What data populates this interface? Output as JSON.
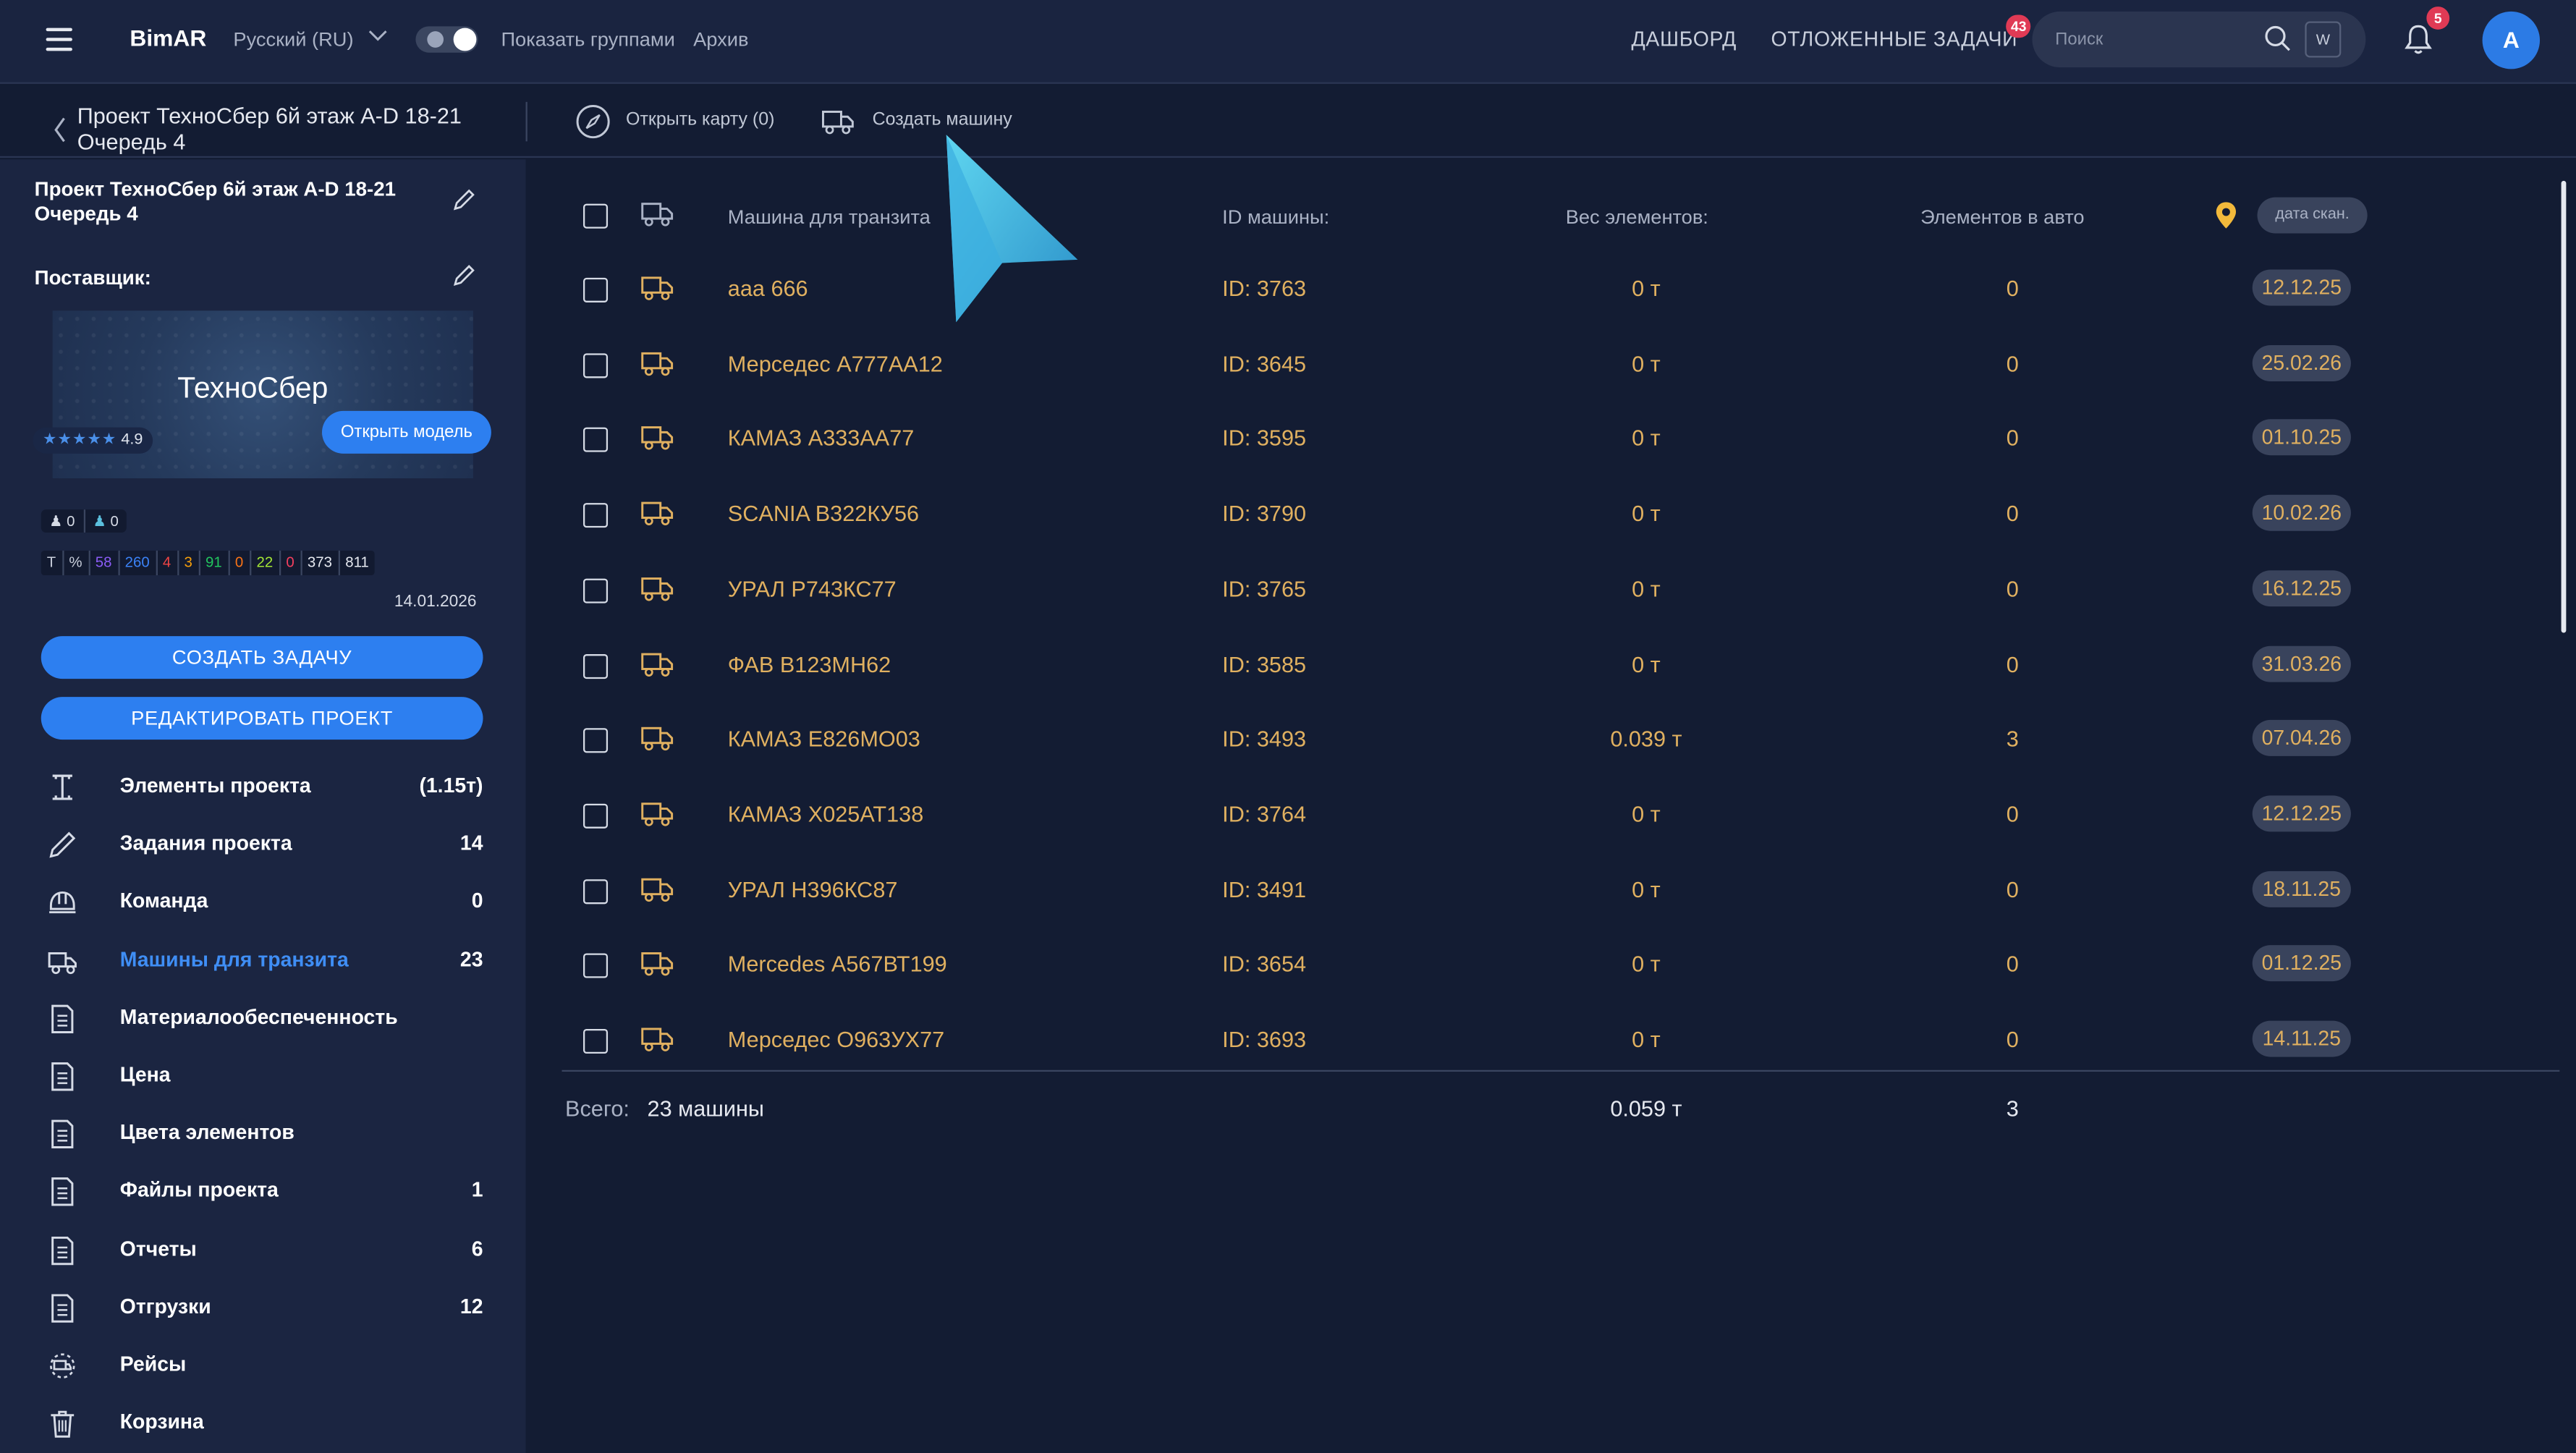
{
  "topbar": {
    "brand": "BimAR",
    "language": "Русский (RU)",
    "show_groups": "Показать группами",
    "archive": "Архив",
    "nav_dashboard": "ДАШБОРД",
    "nav_postponed": "ОТЛОЖЕННЫЕ ЗАДАЧИ",
    "postponed_badge": "43",
    "search_placeholder": "Поиск",
    "search_w": "W",
    "notifications_badge": "5",
    "avatar_letter": "A"
  },
  "subheader": {
    "project_title_line1": "Проект ТехноСбер 6й этаж A-D 18-21",
    "project_title_line2": "Очередь 4",
    "open_map": "Открыть карту (0)",
    "create_car": "Создать машину"
  },
  "sidebar": {
    "project_line1": "Проект ТехноСбер 6й этаж A-D 18-21",
    "project_line2": "Очередь 4",
    "supplier_label": "Поставщик:",
    "supplier_name": "ТехноСбер",
    "rating_stars": "★★★★★",
    "rating_value": "4.9",
    "open_model": "Открыть модель",
    "counts": [
      "0",
      "0"
    ],
    "stats": [
      {
        "text": "T",
        "color": "#c9cfdc"
      },
      {
        "text": "%",
        "color": "#c9cfdc"
      },
      {
        "text": "58",
        "color": "#8b5cf6"
      },
      {
        "text": "260",
        "color": "#3b82f6"
      },
      {
        "text": "4",
        "color": "#ef4444"
      },
      {
        "text": "3",
        "color": "#f59e0b"
      },
      {
        "text": "91",
        "color": "#22c55e"
      },
      {
        "text": "0",
        "color": "#f97316"
      },
      {
        "text": "22",
        "color": "#a3e635"
      },
      {
        "text": "0",
        "color": "#f43f5e"
      },
      {
        "text": "373",
        "color": "#e6e9f0"
      },
      {
        "text": "811",
        "color": "#e6e9f0"
      }
    ],
    "date": "14.01.2026",
    "create_task": "СОЗДАТЬ ЗАДАЧУ",
    "edit_project": "РЕДАКТИРОВАТЬ ПРОЕКТ",
    "menu": [
      {
        "label": "Элементы проекта",
        "count": "(1.15т)",
        "icon": "beam-icon"
      },
      {
        "label": "Задания проекта",
        "count": "14",
        "icon": "pencil-icon"
      },
      {
        "label": "Команда",
        "count": "0",
        "icon": "helmet-icon"
      },
      {
        "label": "Машины для транзита",
        "count": "23",
        "icon": "truck-icon",
        "active": true
      },
      {
        "label": "Материалообеспеченность",
        "count": "",
        "icon": "document-icon"
      },
      {
        "label": "Цена",
        "count": "",
        "icon": "document-icon"
      },
      {
        "label": "Цвета элементов",
        "count": "",
        "icon": "document-icon"
      },
      {
        "label": "Файлы проекта",
        "count": "1",
        "icon": "document-icon"
      },
      {
        "label": "Отчеты",
        "count": "6",
        "icon": "document-icon"
      },
      {
        "label": "Отгрузки",
        "count": "12",
        "icon": "document-icon"
      },
      {
        "label": "Рейсы",
        "count": "",
        "icon": "route-icon"
      },
      {
        "label": "Корзина",
        "count": "",
        "icon": "trash-icon"
      }
    ]
  },
  "table": {
    "headers": {
      "name": "Машина для транзита",
      "id": "ID машины:",
      "weight": "Вес элементов:",
      "count": "Элементов в авто",
      "scan": "дата скан."
    },
    "rows": [
      {
        "name": "ааа 666",
        "id": "ID: 3763",
        "weight": "0 т",
        "count": "0",
        "date": "12.12.25"
      },
      {
        "name": "Мерседес А777АА12",
        "id": "ID: 3645",
        "weight": "0 т",
        "count": "0",
        "date": "25.02.26"
      },
      {
        "name": "КАМАЗ А333АА77",
        "id": "ID: 3595",
        "weight": "0 т",
        "count": "0",
        "date": "01.10.25"
      },
      {
        "name": "SCANIA В322КУ56",
        "id": "ID: 3790",
        "weight": "0 т",
        "count": "0",
        "date": "10.02.26"
      },
      {
        "name": "УРАЛ Р743КС77",
        "id": "ID: 3765",
        "weight": "0 т",
        "count": "0",
        "date": "16.12.25"
      },
      {
        "name": "ФАВ В123МН62",
        "id": "ID: 3585",
        "weight": "0 т",
        "count": "0",
        "date": "31.03.26"
      },
      {
        "name": "КАМАЗ Е826МО03",
        "id": "ID: 3493",
        "weight": "0.039 т",
        "count": "3",
        "date": "07.04.26"
      },
      {
        "name": "КАМАЗ Х025АТ138",
        "id": "ID: 3764",
        "weight": "0 т",
        "count": "0",
        "date": "12.12.25"
      },
      {
        "name": "УРАЛ Н396КС87",
        "id": "ID: 3491",
        "weight": "0 т",
        "count": "0",
        "date": "18.11.25"
      },
      {
        "name": "Mercedes А567ВТ199",
        "id": "ID: 3654",
        "weight": "0 т",
        "count": "0",
        "date": "01.12.25"
      },
      {
        "name": "Мерседес О963УХ77",
        "id": "ID: 3693",
        "weight": "0 т",
        "count": "0",
        "date": "14.11.25"
      }
    ],
    "total_label": "Всего:",
    "total_value": "23 машины",
    "total_weight": "0.059 т",
    "total_count": "3"
  }
}
